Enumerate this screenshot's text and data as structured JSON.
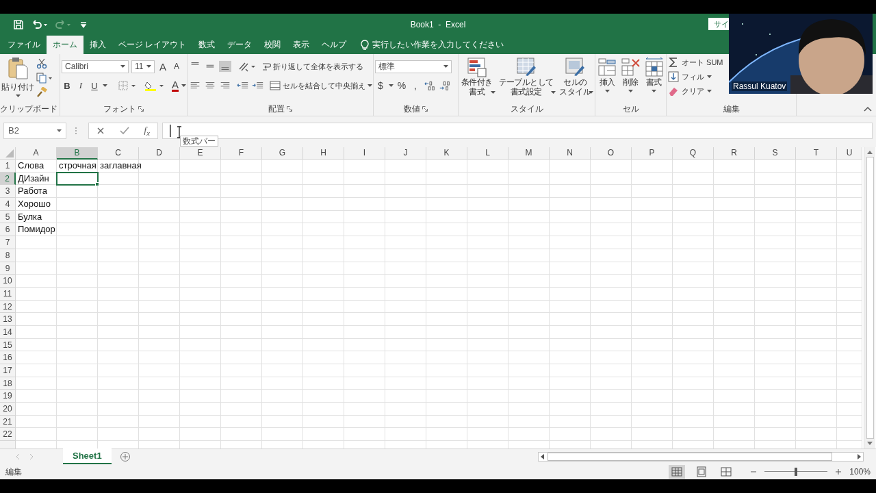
{
  "title_bar": {
    "title": "Book1  -  Excel",
    "account_button": "サイ"
  },
  "tabs": [
    {
      "label": "ファイル",
      "selected": false
    },
    {
      "label": "ホーム",
      "selected": true
    },
    {
      "label": "挿入",
      "selected": false
    },
    {
      "label": "ページ レイアウト",
      "selected": false
    },
    {
      "label": "数式",
      "selected": false
    },
    {
      "label": "データ",
      "selected": false
    },
    {
      "label": "校閲",
      "selected": false
    },
    {
      "label": "表示",
      "selected": false
    },
    {
      "label": "ヘルプ",
      "selected": false
    }
  ],
  "tell_me": "実行したい作業を入力してください",
  "ribbon": {
    "clipboard": {
      "label": "クリップボード",
      "paste": "貼り付け"
    },
    "font": {
      "label": "フォント",
      "font_name": "Calibri",
      "font_size": "11",
      "grow": "A",
      "shrink": "A",
      "bold": "B",
      "italic": "I",
      "underline": "U",
      "font_color": "A"
    },
    "alignment": {
      "label": "配置",
      "wrap_text": "折り返して全体を表示する",
      "merge": "セルを結合して中央揃え",
      "vertical_align": [
        {
          "kind": "top",
          "selected": false
        },
        {
          "kind": "middle",
          "selected": false
        },
        {
          "kind": "bottom",
          "selected": true
        }
      ]
    },
    "number": {
      "label": "数値",
      "format": "標準",
      "currency": "$",
      "percent": "%",
      "comma": ","
    },
    "styles": {
      "label": "スタイル",
      "buttons": [
        {
          "kind": "conditional",
          "lines": [
            "条件付き",
            "書式"
          ]
        },
        {
          "kind": "table",
          "lines": [
            "テーブルとして",
            "書式設定"
          ]
        },
        {
          "kind": "cell",
          "lines": [
            "セルの",
            "スタイル"
          ]
        }
      ]
    },
    "cells": {
      "label": "セル",
      "buttons": [
        {
          "kind": "insert",
          "label": "挿入"
        },
        {
          "kind": "delete",
          "label": "削除"
        },
        {
          "kind": "format",
          "label": "書式"
        }
      ]
    },
    "editing": {
      "label": "編集",
      "items": [
        {
          "kind": "sum",
          "label": "オート SUM"
        },
        {
          "kind": "fill",
          "label": "フィル"
        },
        {
          "kind": "clear",
          "label": "クリア"
        }
      ]
    }
  },
  "formula_bar": {
    "name_box": "B2",
    "function_button": "f$_{x}$",
    "tooltip": "数式バー"
  },
  "sheet": {
    "columns": [
      {
        "label": "A",
        "selected": false
      },
      {
        "label": "B",
        "selected": true
      },
      {
        "label": "C",
        "selected": false
      },
      {
        "label": "D",
        "selected": false
      },
      {
        "label": "E",
        "selected": false
      },
      {
        "label": "F",
        "selected": false
      },
      {
        "label": "G",
        "selected": false
      },
      {
        "label": "H",
        "selected": false
      },
      {
        "label": "I",
        "selected": false
      },
      {
        "label": "J",
        "selected": false
      },
      {
        "label": "K",
        "selected": false
      },
      {
        "label": "L",
        "selected": false
      },
      {
        "label": "M",
        "selected": false
      },
      {
        "label": "N",
        "selected": false
      },
      {
        "label": "O",
        "selected": false
      },
      {
        "label": "P",
        "selected": false
      },
      {
        "label": "Q",
        "selected": false
      },
      {
        "label": "R",
        "selected": false
      },
      {
        "label": "S",
        "selected": false
      },
      {
        "label": "T",
        "selected": false
      },
      {
        "label": "U",
        "selected": false
      }
    ],
    "rows": [
      {
        "label": "1",
        "selected": false,
        "cells": [
          "Слова",
          "строчная",
          "заглавная"
        ]
      },
      {
        "label": "2",
        "selected": true,
        "cells": [
          "ДИзайн"
        ]
      },
      {
        "label": "3",
        "selected": false,
        "cells": [
          "Работа"
        ]
      },
      {
        "label": "4",
        "selected": false,
        "cells": [
          "Хорошо"
        ]
      },
      {
        "label": "5",
        "selected": false,
        "cells": [
          "Булка"
        ]
      },
      {
        "label": "6",
        "selected": false,
        "cells": [
          "Помидор"
        ]
      },
      {
        "label": "7",
        "selected": false
      },
      {
        "label": "8",
        "selected": false
      },
      {
        "label": "9",
        "selected": false
      },
      {
        "label": "10",
        "selected": false
      },
      {
        "label": "11",
        "selected": false
      },
      {
        "label": "12",
        "selected": false
      },
      {
        "label": "13",
        "selected": false
      },
      {
        "label": "14",
        "selected": false
      },
      {
        "label": "15",
        "selected": false
      },
      {
        "label": "16",
        "selected": false
      },
      {
        "label": "17",
        "selected": false
      },
      {
        "label": "18",
        "selected": false
      },
      {
        "label": "19",
        "selected": false
      },
      {
        "label": "20",
        "selected": false
      },
      {
        "label": "21",
        "selected": false
      },
      {
        "label": "22",
        "selected": false
      }
    ]
  },
  "sheet_tabs": [
    {
      "label": "Sheet1",
      "selected": true
    }
  ],
  "status_bar": {
    "mode": "編集",
    "views": [
      {
        "kind": "normal",
        "selected": true
      },
      {
        "kind": "page_layout",
        "selected": false
      },
      {
        "kind": "page_break",
        "selected": false
      }
    ],
    "zoom": {
      "level": 0.5,
      "reading": "100%"
    }
  },
  "webcam": {
    "name": "Rassul Kuatov"
  }
}
